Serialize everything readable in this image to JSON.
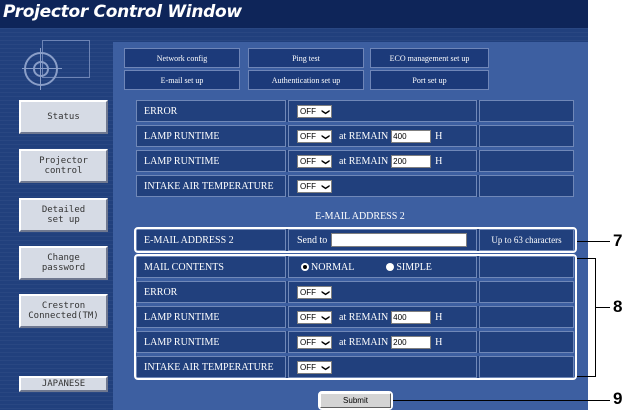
{
  "window": {
    "title": "Projector Control Window"
  },
  "sidebar": {
    "items": [
      {
        "label": "Status"
      },
      {
        "label": "Projector\ncontrol"
      },
      {
        "label": "Detailed\nset up"
      },
      {
        "label": "Change\npassword"
      },
      {
        "label": "Crestron\nConnected(TM)"
      },
      {
        "label": "JAPANESE"
      }
    ]
  },
  "tabs": {
    "row1": [
      {
        "label": "Network config"
      },
      {
        "label": "Ping test"
      },
      {
        "label": "ECO management set up"
      }
    ],
    "row2": [
      {
        "label": "E-mail set up",
        "active": true
      },
      {
        "label": "Authentication set up"
      },
      {
        "label": "Port set up"
      }
    ]
  },
  "address1_conditions": {
    "error": {
      "label": "ERROR",
      "value": "OFF"
    },
    "lamp1": {
      "label": "LAMP  RUNTIME",
      "value": "OFF",
      "remain_label": "at REMAIN",
      "remain_value": "400",
      "unit": "H"
    },
    "lamp2": {
      "label": "LAMP  RUNTIME",
      "value": "OFF",
      "remain_label": "at REMAIN",
      "remain_value": "200",
      "unit": "H"
    },
    "intake": {
      "label": "INTAKE AIR TEMPERATURE",
      "value": "OFF"
    }
  },
  "address2": {
    "section_title": "E-MAIL ADDRESS 2",
    "field_label": "E-MAIL ADDRESS 2",
    "send_to": "Send to",
    "value": "",
    "hint": "Up to 63 characters",
    "mail_contents": {
      "label": "MAIL CONTENTS",
      "option_normal": "NORMAL",
      "option_simple": "SIMPLE",
      "selected": "NORMAL"
    },
    "error": {
      "label": "ERROR",
      "value": "OFF"
    },
    "lamp1": {
      "label": "LAMP  RUNTIME",
      "value": "OFF",
      "remain_label": "at REMAIN",
      "remain_value": "400",
      "unit": "H"
    },
    "lamp2": {
      "label": "LAMP  RUNTIME",
      "value": "OFF",
      "remain_label": "at REMAIN",
      "remain_value": "200",
      "unit": "H"
    },
    "intake": {
      "label": "INTAKE AIR TEMPERATURE",
      "value": "OFF"
    }
  },
  "submit_label": "Submit",
  "callouts": {
    "c7": "7",
    "c8": "8",
    "c9": "9"
  },
  "dropdown_arrow": "❯"
}
